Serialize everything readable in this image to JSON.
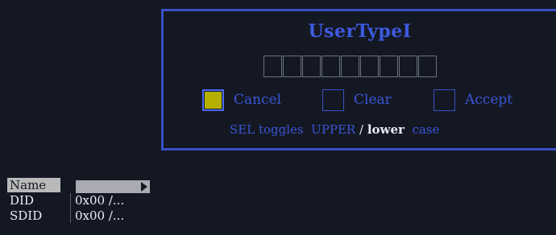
{
  "dialog": {
    "title": "UserTypeI",
    "char_box_count": 9,
    "options": [
      {
        "label": "Cancel",
        "selected": true
      },
      {
        "label": "Clear",
        "selected": false
      },
      {
        "label": "Accept",
        "selected": false
      }
    ],
    "hint": {
      "prefix": "SEL toggles",
      "upper": "UPPER",
      "sep": "/",
      "lower": "lower",
      "suffix": "case",
      "active": "lower"
    }
  },
  "info": {
    "rows": [
      {
        "key": "Name",
        "value": "",
        "highlighted": true
      },
      {
        "key": "DID",
        "value": "0x00 /...",
        "highlighted": false
      },
      {
        "key": "SDID",
        "value": "0x00 /...",
        "highlighted": false
      }
    ]
  },
  "colors": {
    "background": "#141823",
    "accent_blue": "#3a4fc4",
    "selected_fill": "#b5b000",
    "text_white": "#e9ecf4"
  }
}
